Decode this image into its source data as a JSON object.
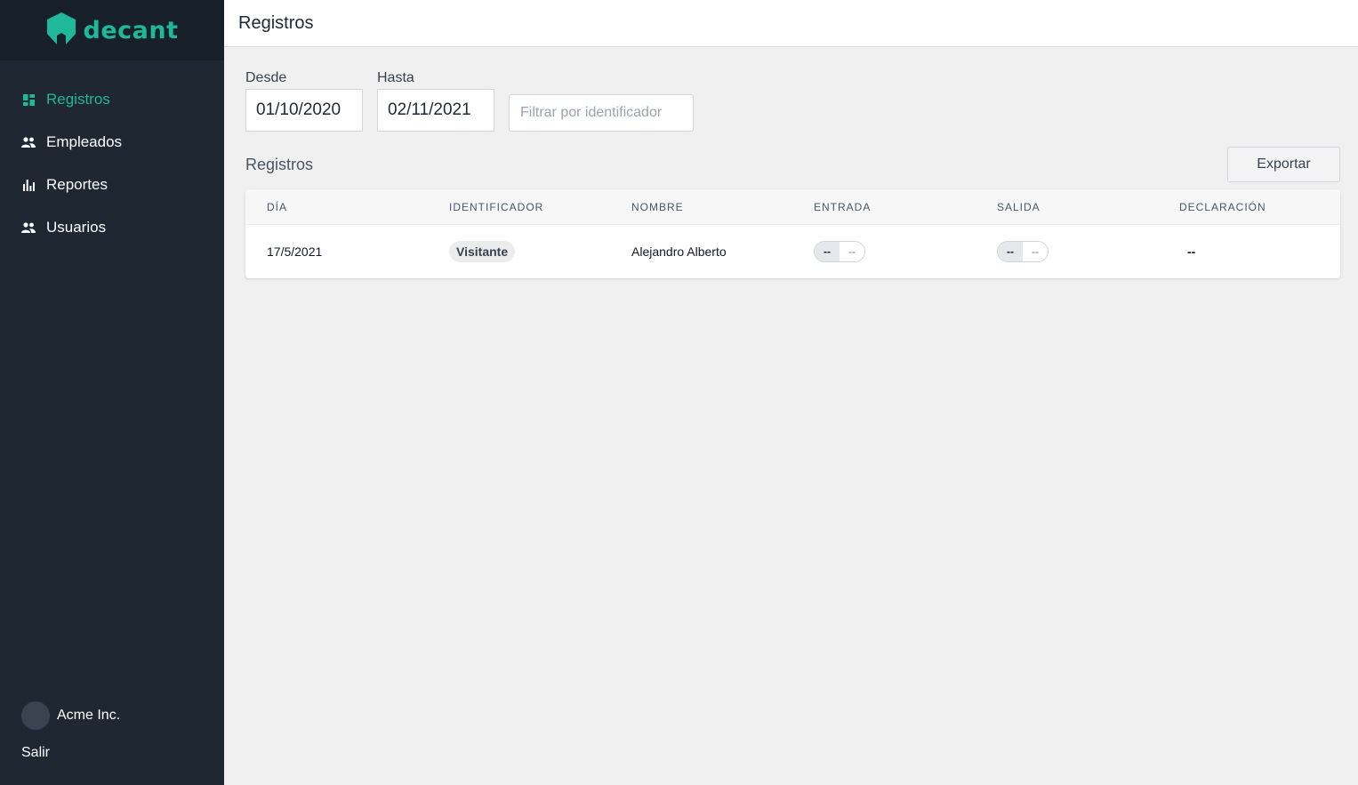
{
  "brand": {
    "name": "decant",
    "color": "#1fb89a"
  },
  "sidebar": {
    "items": [
      {
        "label": "Registros",
        "icon": "dashboard-icon",
        "active": true
      },
      {
        "label": "Empleados",
        "icon": "people-icon",
        "active": false
      },
      {
        "label": "Reportes",
        "icon": "bar-chart-icon",
        "active": false
      },
      {
        "label": "Usuarios",
        "icon": "people-icon",
        "active": false
      }
    ],
    "org_name": "Acme Inc.",
    "logout_label": "Salir"
  },
  "header": {
    "title": "Registros"
  },
  "filters": {
    "desde_label": "Desde",
    "desde_value": "01/10/2020",
    "hasta_label": "Hasta",
    "hasta_value": "02/11/2021",
    "identifier_placeholder": "Filtrar por identificador"
  },
  "section": {
    "title": "Registros",
    "export_label": "Exportar"
  },
  "table": {
    "columns": [
      "DÍA",
      "IDENTIFICADOR",
      "NOMBRE",
      "ENTRADA",
      "SALIDA",
      "DECLARACIÓN"
    ],
    "rows": [
      {
        "dia": "17/5/2021",
        "identificador": "Visitante",
        "nombre": "Alejandro Alberto",
        "entrada": [
          "--",
          "--"
        ],
        "salida": [
          "--",
          "--"
        ],
        "declaracion": "--"
      }
    ]
  }
}
